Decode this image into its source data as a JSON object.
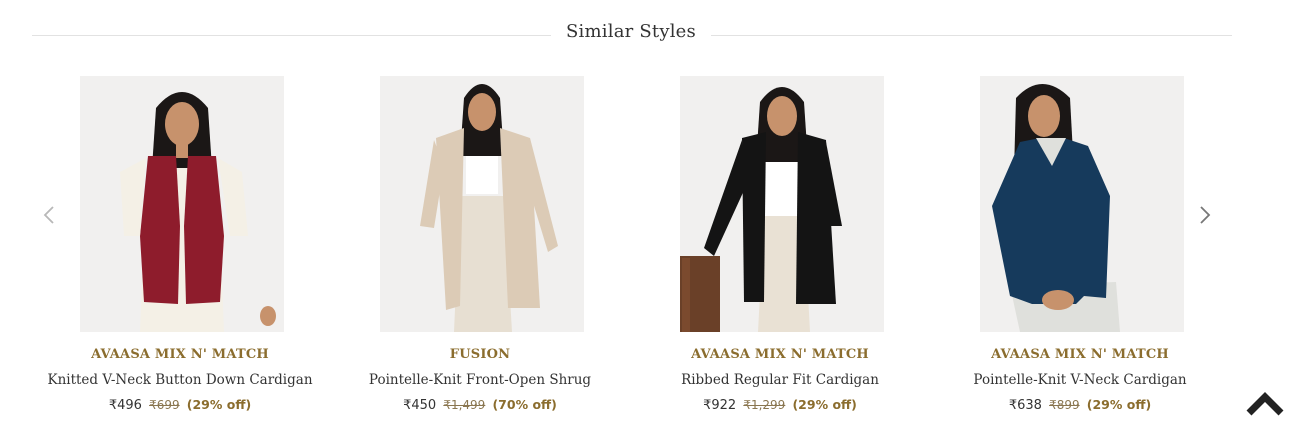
{
  "section": {
    "title": "Similar Styles"
  },
  "products": [
    {
      "brand": "AVAASA MIX N' MATCH",
      "name": "Knitted V-Neck Button Down Cardigan",
      "price": "₹496",
      "original_price": "₹699",
      "discount": "(29% off)",
      "garment_color": "#8e1c2c"
    },
    {
      "brand": "FUSION",
      "name": "Pointelle-Knit Front-Open Shrug",
      "price": "₹450",
      "original_price": "₹1,499",
      "discount": "(70% off)",
      "garment_color": "#dccbb6"
    },
    {
      "brand": "AVAASA MIX N' MATCH",
      "name": "Ribbed Regular Fit Cardigan",
      "price": "₹922",
      "original_price": "₹1,299",
      "discount": "(29% off)",
      "garment_color": "#141414"
    },
    {
      "brand": "AVAASA MIX N' MATCH",
      "name": "Pointelle-Knit V-Neck Cardigan",
      "price": "₹638",
      "original_price": "₹899",
      "discount": "(29% off)",
      "garment_color": "#163a5c"
    }
  ],
  "icons": {
    "prev": "chevron-left-icon",
    "next": "chevron-right-icon",
    "scroll_top": "chevron-up-icon"
  },
  "colors": {
    "brand_text": "#8b6d2e",
    "discount_text": "#8b6d2e",
    "arrow": "#999999"
  }
}
